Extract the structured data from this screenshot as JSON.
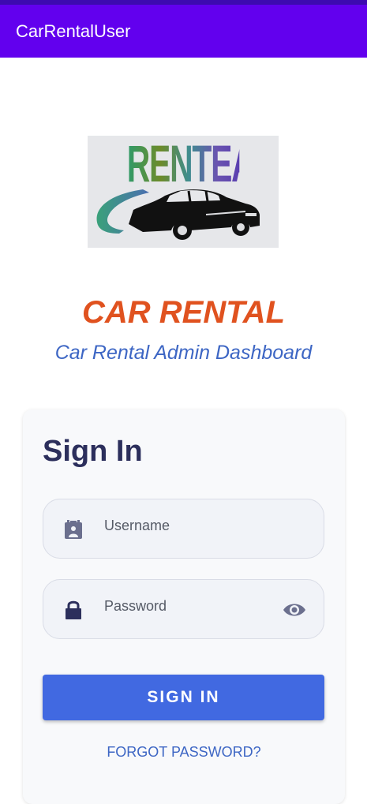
{
  "app_bar": {
    "title": "CarRentalUser",
    "color": "#6200ee"
  },
  "logo": {
    "wordmark": "RENTEASY"
  },
  "brand": {
    "title": "CAR RENTAL",
    "subtitle": "Car Rental Admin Dashboard",
    "title_color": "#e0521f",
    "subtitle_color": "#3d66c4"
  },
  "signin": {
    "heading": "Sign In",
    "username": {
      "placeholder": "Username",
      "icon": "badge-icon"
    },
    "password": {
      "placeholder": "Password",
      "icon": "lock-icon",
      "toggle_icon": "eye-icon"
    },
    "button_label": "SIGN IN",
    "button_color": "#4169e1",
    "forgot_label": "FORGOT PASSWORD?"
  }
}
